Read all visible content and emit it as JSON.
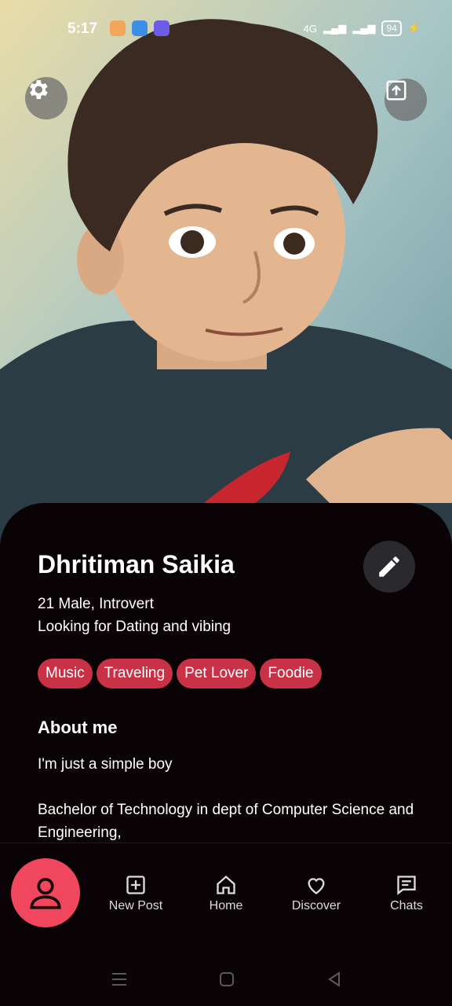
{
  "status_bar": {
    "time": "5:17",
    "network": "4G",
    "battery": "94"
  },
  "profile": {
    "name": "Dhritiman Saikia",
    "details": "21 Male, Introvert",
    "looking_for": "Looking for Dating and vibing",
    "interests": [
      "Music",
      "Traveling",
      "Pet Lover",
      "Foodie"
    ]
  },
  "about": {
    "heading": "About me",
    "paragraph1": "I'm just a simple boy",
    "paragraph2": "Bachelor of Technology in dept of Computer Science and Engineering,"
  },
  "nav": {
    "new_post": "New Post",
    "home": "Home",
    "discover": "Discover",
    "chats": "Chats"
  },
  "colors": {
    "accent": "#f0475e",
    "tag": "#c83146",
    "background": "#0a0306"
  }
}
